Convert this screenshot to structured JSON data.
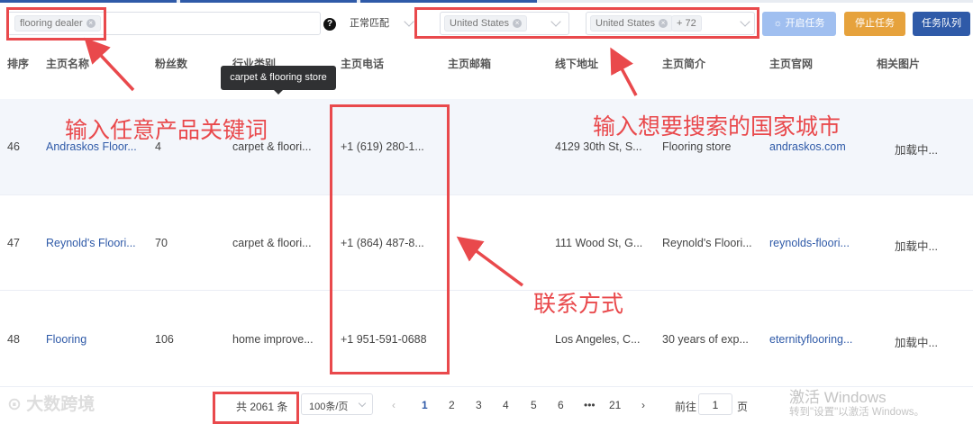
{
  "toolbar": {
    "keyword_tag": "flooring dealer",
    "match_mode": "正常匹配",
    "help_icon": "?",
    "country_select_1": "United States",
    "country_select_2": "United States",
    "more_count": "+ 72",
    "start_button": "开启任务",
    "stop_button": "停止任务",
    "queue_button": "任务队列"
  },
  "table": {
    "headers": [
      "排序",
      "主页名称",
      "粉丝数",
      "行业类别",
      "主页电话",
      "主页邮箱",
      "线下地址",
      "主页简介",
      "主页官网",
      "相关图片"
    ],
    "tooltip": "carpet & flooring store",
    "rows": [
      {
        "index": "46",
        "name": "Andraskos Floor...",
        "fans": "4",
        "category": "carpet & floori...",
        "phone": "+1 (619) 280-1...",
        "email": "",
        "address": "4129 30th St, S...",
        "intro": "Flooring store",
        "site": "andraskos.com",
        "images": "加载中..."
      },
      {
        "index": "47",
        "name": "Reynold's Floori...",
        "fans": "70",
        "category": "carpet & floori...",
        "phone": "+1 (864) 487-8...",
        "email": "",
        "address": "111 Wood St, G...",
        "intro": "Reynold's Floori...",
        "site": "reynolds-floori...",
        "images": "加载中..."
      },
      {
        "index": "48",
        "name": "Flooring",
        "fans": "106",
        "category": "home improve...",
        "phone": "+1 951-591-0688",
        "email": "",
        "address": "Los Angeles, C...",
        "intro": "30 years of exp...",
        "site": "eternityflooring...",
        "images": "加载中..."
      }
    ]
  },
  "annotations": {
    "keyword": "输入任意产品关键词",
    "country": "输入想要搜索的国家城市",
    "contact": "联系方式"
  },
  "pagination": {
    "total": "共 2061 条",
    "page_size": "100条/页",
    "pages": [
      "1",
      "2",
      "3",
      "4",
      "5",
      "6",
      "•••",
      "21"
    ],
    "goto_label": "前往",
    "goto_value": "1",
    "page_suffix": "页"
  },
  "watermarks": {
    "brand": "大数跨境",
    "activate_title": "激活 Windows",
    "activate_sub": "转到\"设置\"以激活 Windows。"
  },
  "colors": {
    "accent": "#2f5aa8",
    "annotation_red": "#e9494c",
    "stop_orange": "#e6a23c",
    "start_disabled": "#a0bff0"
  }
}
